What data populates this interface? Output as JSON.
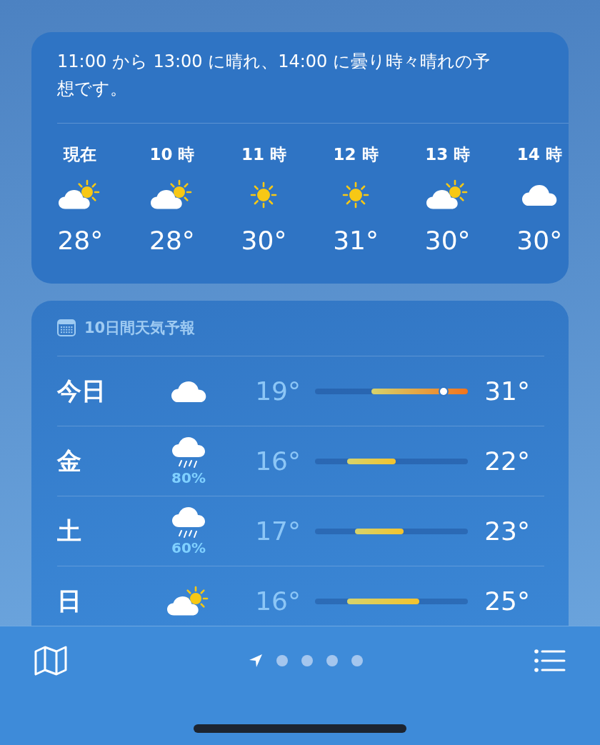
{
  "summary": "11:00 から 13:00 に晴れ、14:00 に曇り時々晴れの予想です。",
  "hourly": [
    {
      "time": "現在",
      "kind": "partly_cloudy",
      "temp": "28°"
    },
    {
      "time": "10 時",
      "kind": "partly_cloudy",
      "temp": "28°"
    },
    {
      "time": "11 時",
      "kind": "sunny",
      "temp": "30°"
    },
    {
      "time": "12 時",
      "kind": "sunny",
      "temp": "31°"
    },
    {
      "time": "13 時",
      "kind": "partly_cloudy",
      "temp": "30°"
    },
    {
      "time": "14 時",
      "kind": "cloudy",
      "temp": "30°"
    }
  ],
  "forecast": {
    "title": "10日間天気予報",
    "days": [
      {
        "day": "今日",
        "kind": "cloudy",
        "low": "19°",
        "high": "31°",
        "current": true
      },
      {
        "day": "金",
        "kind": "rain",
        "chance": "80%",
        "low": "16°",
        "high": "22°",
        "current": false
      },
      {
        "day": "土",
        "kind": "rain",
        "chance": "60%",
        "low": "17°",
        "high": "23°",
        "current": false
      },
      {
        "day": "日",
        "kind": "partly_cloudy",
        "low": "16°",
        "high": "25°",
        "current": false
      }
    ]
  },
  "bottom_bar": {
    "pages": [
      {
        "kind": "location",
        "selected": true
      },
      {
        "kind": "dot",
        "selected": false
      },
      {
        "kind": "dot",
        "selected": false
      },
      {
        "kind": "dot",
        "selected": false
      },
      {
        "kind": "dot",
        "selected": false
      }
    ]
  }
}
